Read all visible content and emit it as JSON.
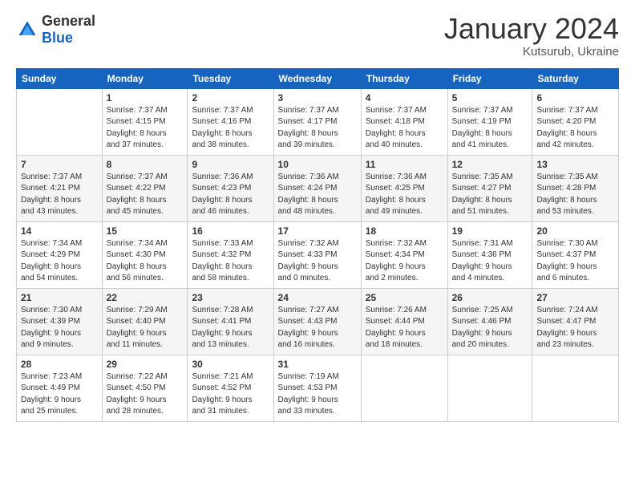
{
  "header": {
    "logo": {
      "general": "General",
      "blue": "Blue"
    },
    "title": "January 2024",
    "location": "Kutsurub, Ukraine"
  },
  "calendar": {
    "weekdays": [
      "Sunday",
      "Monday",
      "Tuesday",
      "Wednesday",
      "Thursday",
      "Friday",
      "Saturday"
    ],
    "weeks": [
      [
        {
          "day": "",
          "info": ""
        },
        {
          "day": "1",
          "info": "Sunrise: 7:37 AM\nSunset: 4:15 PM\nDaylight: 8 hours\nand 37 minutes."
        },
        {
          "day": "2",
          "info": "Sunrise: 7:37 AM\nSunset: 4:16 PM\nDaylight: 8 hours\nand 38 minutes."
        },
        {
          "day": "3",
          "info": "Sunrise: 7:37 AM\nSunset: 4:17 PM\nDaylight: 8 hours\nand 39 minutes."
        },
        {
          "day": "4",
          "info": "Sunrise: 7:37 AM\nSunset: 4:18 PM\nDaylight: 8 hours\nand 40 minutes."
        },
        {
          "day": "5",
          "info": "Sunrise: 7:37 AM\nSunset: 4:19 PM\nDaylight: 8 hours\nand 41 minutes."
        },
        {
          "day": "6",
          "info": "Sunrise: 7:37 AM\nSunset: 4:20 PM\nDaylight: 8 hours\nand 42 minutes."
        }
      ],
      [
        {
          "day": "7",
          "info": "Sunrise: 7:37 AM\nSunset: 4:21 PM\nDaylight: 8 hours\nand 43 minutes."
        },
        {
          "day": "8",
          "info": "Sunrise: 7:37 AM\nSunset: 4:22 PM\nDaylight: 8 hours\nand 45 minutes."
        },
        {
          "day": "9",
          "info": "Sunrise: 7:36 AM\nSunset: 4:23 PM\nDaylight: 8 hours\nand 46 minutes."
        },
        {
          "day": "10",
          "info": "Sunrise: 7:36 AM\nSunset: 4:24 PM\nDaylight: 8 hours\nand 48 minutes."
        },
        {
          "day": "11",
          "info": "Sunrise: 7:36 AM\nSunset: 4:25 PM\nDaylight: 8 hours\nand 49 minutes."
        },
        {
          "day": "12",
          "info": "Sunrise: 7:35 AM\nSunset: 4:27 PM\nDaylight: 8 hours\nand 51 minutes."
        },
        {
          "day": "13",
          "info": "Sunrise: 7:35 AM\nSunset: 4:28 PM\nDaylight: 8 hours\nand 53 minutes."
        }
      ],
      [
        {
          "day": "14",
          "info": "Sunrise: 7:34 AM\nSunset: 4:29 PM\nDaylight: 8 hours\nand 54 minutes."
        },
        {
          "day": "15",
          "info": "Sunrise: 7:34 AM\nSunset: 4:30 PM\nDaylight: 8 hours\nand 56 minutes."
        },
        {
          "day": "16",
          "info": "Sunrise: 7:33 AM\nSunset: 4:32 PM\nDaylight: 8 hours\nand 58 minutes."
        },
        {
          "day": "17",
          "info": "Sunrise: 7:32 AM\nSunset: 4:33 PM\nDaylight: 9 hours\nand 0 minutes."
        },
        {
          "day": "18",
          "info": "Sunrise: 7:32 AM\nSunset: 4:34 PM\nDaylight: 9 hours\nand 2 minutes."
        },
        {
          "day": "19",
          "info": "Sunrise: 7:31 AM\nSunset: 4:36 PM\nDaylight: 9 hours\nand 4 minutes."
        },
        {
          "day": "20",
          "info": "Sunrise: 7:30 AM\nSunset: 4:37 PM\nDaylight: 9 hours\nand 6 minutes."
        }
      ],
      [
        {
          "day": "21",
          "info": "Sunrise: 7:30 AM\nSunset: 4:39 PM\nDaylight: 9 hours\nand 9 minutes."
        },
        {
          "day": "22",
          "info": "Sunrise: 7:29 AM\nSunset: 4:40 PM\nDaylight: 9 hours\nand 11 minutes."
        },
        {
          "day": "23",
          "info": "Sunrise: 7:28 AM\nSunset: 4:41 PM\nDaylight: 9 hours\nand 13 minutes."
        },
        {
          "day": "24",
          "info": "Sunrise: 7:27 AM\nSunset: 4:43 PM\nDaylight: 9 hours\nand 16 minutes."
        },
        {
          "day": "25",
          "info": "Sunrise: 7:26 AM\nSunset: 4:44 PM\nDaylight: 9 hours\nand 18 minutes."
        },
        {
          "day": "26",
          "info": "Sunrise: 7:25 AM\nSunset: 4:46 PM\nDaylight: 9 hours\nand 20 minutes."
        },
        {
          "day": "27",
          "info": "Sunrise: 7:24 AM\nSunset: 4:47 PM\nDaylight: 9 hours\nand 23 minutes."
        }
      ],
      [
        {
          "day": "28",
          "info": "Sunrise: 7:23 AM\nSunset: 4:49 PM\nDaylight: 9 hours\nand 25 minutes."
        },
        {
          "day": "29",
          "info": "Sunrise: 7:22 AM\nSunset: 4:50 PM\nDaylight: 9 hours\nand 28 minutes."
        },
        {
          "day": "30",
          "info": "Sunrise: 7:21 AM\nSunset: 4:52 PM\nDaylight: 9 hours\nand 31 minutes."
        },
        {
          "day": "31",
          "info": "Sunrise: 7:19 AM\nSunset: 4:53 PM\nDaylight: 9 hours\nand 33 minutes."
        },
        {
          "day": "",
          "info": ""
        },
        {
          "day": "",
          "info": ""
        },
        {
          "day": "",
          "info": ""
        }
      ]
    ]
  }
}
